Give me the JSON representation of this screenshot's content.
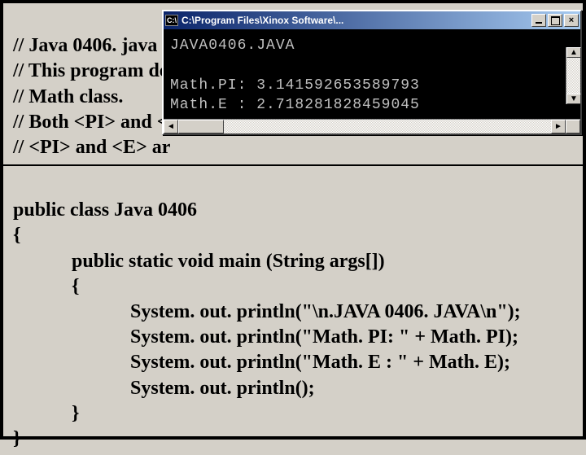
{
  "comments": {
    "l1": "// Java 0406. java",
    "l2": "// This program de",
    "l3": "// Math class.",
    "l4": "// Both <PI> and <",
    "l5": "// <PI> and <E> ar"
  },
  "code": {
    "l1": "public class Java 0406",
    "l2": "{",
    "l3": "public static void main (String args[])",
    "l4": "{",
    "l5": "System. out. println(\"\\n.JAVA 0406. JAVA\\n\");",
    "l6": "System. out. println(\"Math. PI: \" + Math. PI);",
    "l7": "System. out. println(\"Math. E : \" + Math. E);",
    "l8": "System. out. println();",
    "l9": "}",
    "l10": "}"
  },
  "console": {
    "title": "C:\\Program Files\\Xinox Software\\...",
    "icon_label": "C:\\",
    "line1": "JAVA0406.JAVA",
    "line2": "",
    "line3": "Math.PI: 3.141592653589793",
    "line4": "Math.E : 2.718281828459045"
  },
  "window_buttons": {
    "close": "×"
  },
  "scroll": {
    "left": "◄",
    "right": "►",
    "up": "▲",
    "down": "▼"
  }
}
